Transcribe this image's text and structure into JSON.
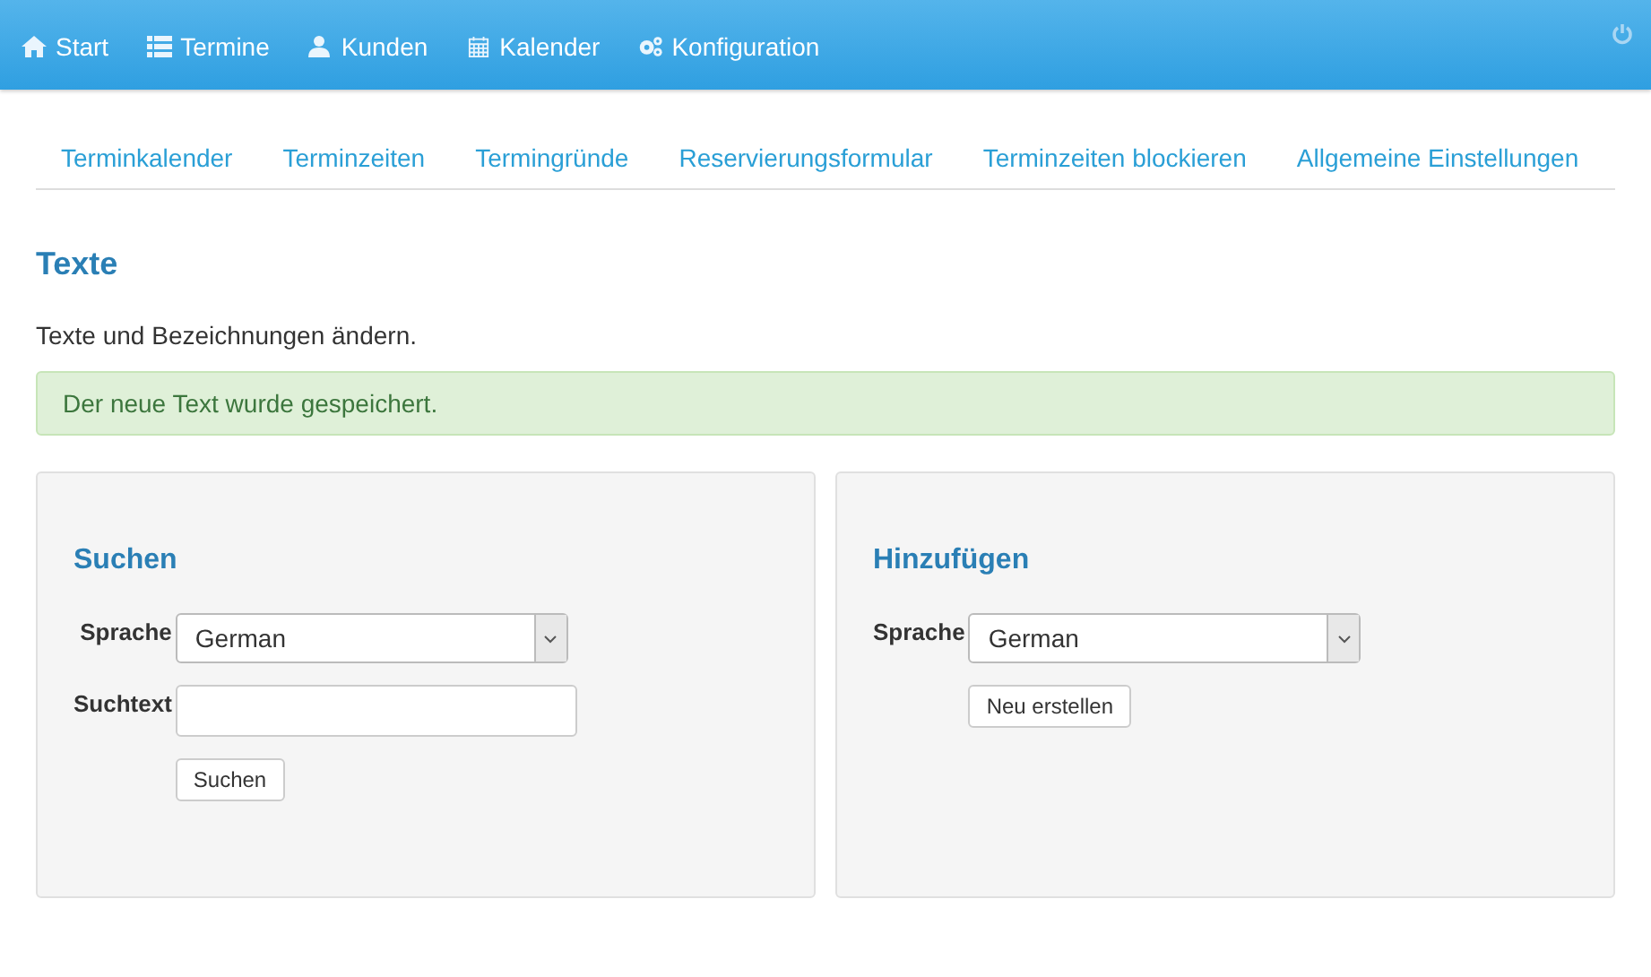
{
  "navbar": {
    "items": [
      {
        "label": "Start",
        "kind": "home"
      },
      {
        "label": "Termine",
        "kind": "list"
      },
      {
        "label": "Kunden",
        "kind": "user"
      },
      {
        "label": "Kalender",
        "kind": "calendar"
      },
      {
        "label": "Konfiguration",
        "kind": "gears"
      }
    ]
  },
  "subnav": {
    "items": [
      "Terminkalender",
      "Terminzeiten",
      "Termingründe",
      "Reservierungsformular",
      "Terminzeiten blockieren",
      "Allgemeine Einstellungen"
    ]
  },
  "page": {
    "title": "Texte",
    "description": "Texte und Bezeichnungen ändern.",
    "alert": "Der neue Text wurde gespeichert."
  },
  "panels": [
    {
      "title": "Suchen",
      "fields": [
        {
          "label": "Sprache",
          "kind": "select",
          "value": "German"
        },
        {
          "label": "Suchtext",
          "kind": "text"
        }
      ],
      "button": "Suchen"
    },
    {
      "title": "Hinzufügen",
      "fields": [
        {
          "label": "Sprache",
          "kind": "select",
          "value": "German"
        }
      ],
      "button": "Neu erstellen"
    }
  ]
}
